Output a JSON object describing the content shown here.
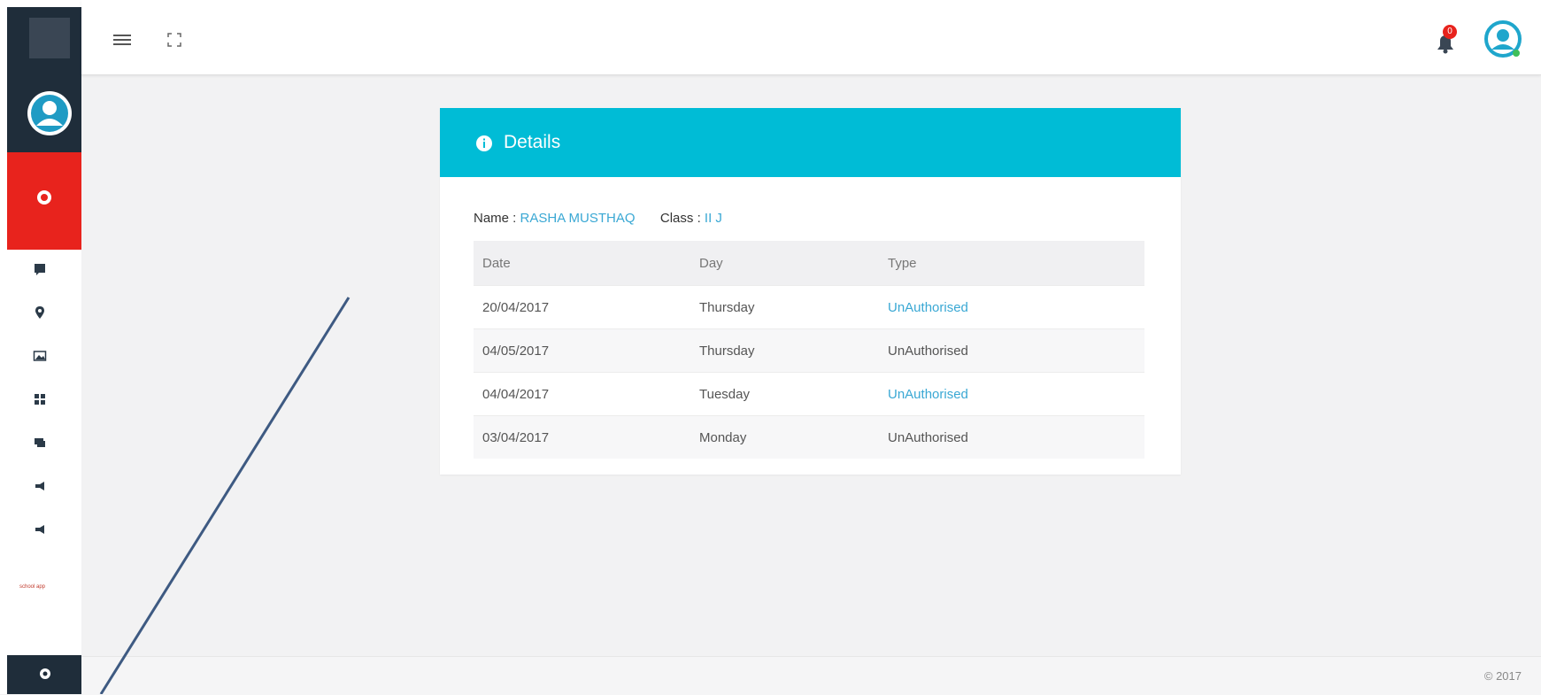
{
  "header": {
    "notification_count": "0"
  },
  "card": {
    "title": "Details",
    "name_label": "Name : ",
    "name_value": "RASHA MUSTHAQ",
    "class_label": "Class : ",
    "class_value": "II J",
    "columns": [
      "Date",
      "Day",
      "Type"
    ],
    "rows": [
      {
        "date": "20/04/2017",
        "day": "Thursday",
        "type": "UnAuthorised"
      },
      {
        "date": "04/05/2017",
        "day": "Thursday",
        "type": "UnAuthorised"
      },
      {
        "date": "04/04/2017",
        "day": "Tuesday",
        "type": "UnAuthorised"
      },
      {
        "date": "03/04/2017",
        "day": "Monday",
        "type": "UnAuthorised"
      }
    ]
  },
  "sidebar": {
    "brand_text": "school app"
  },
  "footer": {
    "copyright": "© 2017"
  },
  "colors": {
    "sidebar_dark": "#1f2d3a",
    "active_red": "#e8231d",
    "header_cyan": "#00bcd6",
    "link_blue": "#3aa8d4"
  },
  "icons": [
    "menu-icon",
    "fullscreen-icon",
    "bell-icon",
    "user-avatar-icon",
    "info-icon",
    "gear-icon"
  ]
}
